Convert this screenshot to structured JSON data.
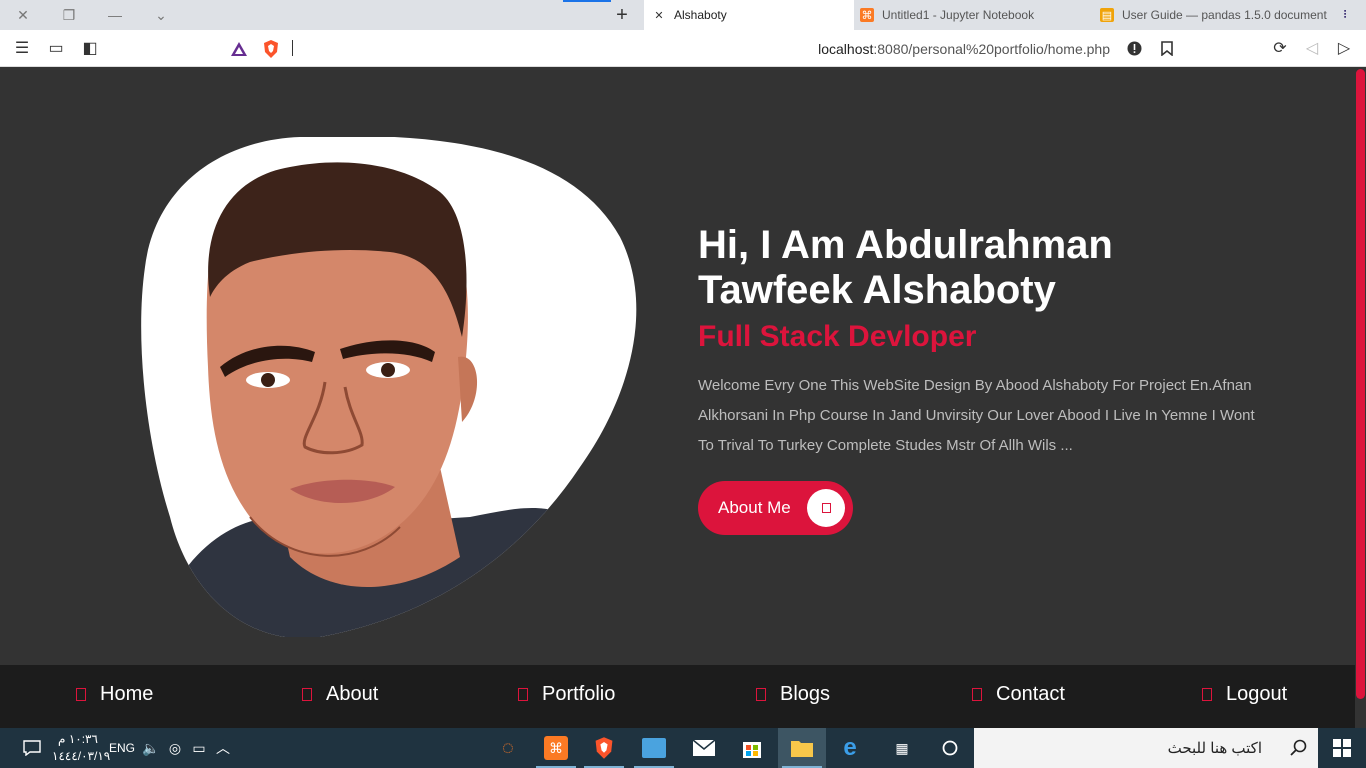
{
  "browser": {
    "tabs": [
      {
        "title": "Alshaboty",
        "active": true,
        "icon": "close-icon"
      },
      {
        "title": "Untitled1 - Jupyter Notebook",
        "active": false,
        "icon": "xampp-icon"
      },
      {
        "title": "User Guide — pandas 1.5.0 document",
        "active": false,
        "icon": "book-icon"
      }
    ],
    "url_host": "localhost",
    "url_rest": ":8080/personal%20portfolio/home.php"
  },
  "hero": {
    "title": "Hi, I Am Abdulrahman Tawfeek Alshaboty",
    "subtitle": "Full Stack Devloper",
    "description": "Welcome Evry One This WebSite Design By Abood Alshaboty For Project En.Afnan Alkhorsani In Php Course In Jand Unvirsity Our Lover Abood I Live In Yemne I Wont To Trival To Turkey Complete Studes Mstr Of Allh Wils ...",
    "button_label": "About Me",
    "accent": "#dc143c"
  },
  "nav": {
    "items": [
      "Home",
      "About",
      "Portfolio",
      "Blogs",
      "Contact",
      "Logout"
    ]
  },
  "taskbar": {
    "time": "١٠:٣٦ م",
    "date": "١٤٤٤/٠٣/١٩",
    "lang": "ENG",
    "search_placeholder": "اكتب هنا للبحث"
  }
}
